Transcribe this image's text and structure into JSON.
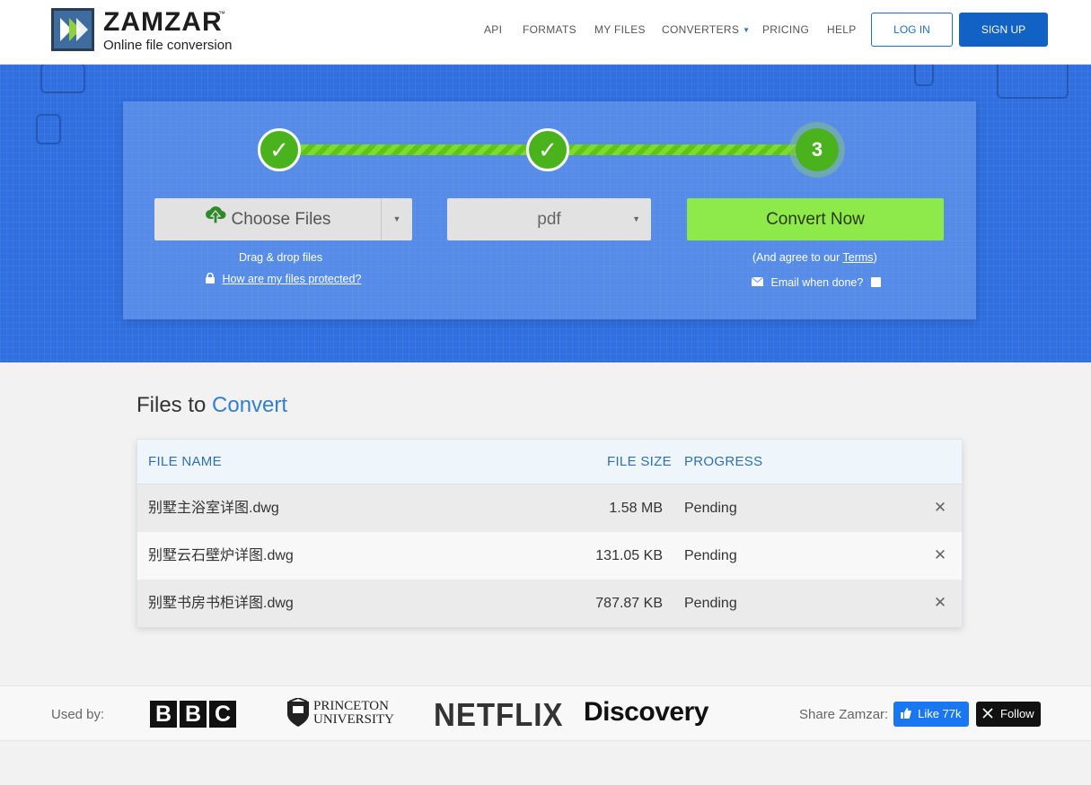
{
  "brand": {
    "name": "ZAMZAR",
    "trademark": "™",
    "tagline": "Online file conversion"
  },
  "nav": {
    "items": [
      "API",
      "FORMATS",
      "MY FILES",
      "CONVERTERS",
      "PRICING",
      "HELP"
    ],
    "login_label": "LOG IN",
    "signup_label": "SIGN UP"
  },
  "steps": {
    "step1": "✓",
    "step2": "✓",
    "step3": "3"
  },
  "upload": {
    "choose_label": "Choose Files",
    "drag_hint": "Drag & drop files",
    "protect_link": "How are my files protected?"
  },
  "format": {
    "selected": "pdf"
  },
  "convert": {
    "button_label": "Convert Now",
    "agree_prefix": "(And agree to our ",
    "terms_link": "Terms",
    "agree_suffix": ")",
    "email_label": "Email when done?"
  },
  "files": {
    "title_prefix": "Files to",
    "title_accent": "Convert",
    "columns": {
      "name": "FILE NAME",
      "size": "FILE SIZE",
      "progress": "PROGRESS"
    },
    "rows": [
      {
        "name": "别墅主浴室详图.dwg",
        "size": "1.58 MB",
        "progress": "Pending"
      },
      {
        "name": "别墅云石壁炉详图.dwg",
        "size": "131.05 KB",
        "progress": "Pending"
      },
      {
        "name": "别墅书房书柜详图.dwg",
        "size": "787.87 KB",
        "progress": "Pending"
      }
    ],
    "remove_glyph": "✕"
  },
  "footer": {
    "used_by_label": "Used by:",
    "logos": {
      "bbc": [
        "B",
        "B",
        "C"
      ],
      "princeton_line1": "PRINCETON",
      "princeton_line2": "UNIVERSITY",
      "netflix": "NETFLIX",
      "discovery": "Discovery"
    },
    "share_label": "Share Zamzar:",
    "like_label": "Like 77k",
    "follow_label": "Follow"
  },
  "colors": {
    "accent_blue": "#1261c4",
    "hero_blue": "#2f6fe0",
    "convert_green": "#8ee94a",
    "step_green": "#4ab21c"
  },
  "icons": [
    "upload-cloud-icon",
    "lock-icon",
    "envelope-icon",
    "close-icon",
    "thumbs-up-icon",
    "x-logo-icon",
    "chevron-down-icon"
  ]
}
